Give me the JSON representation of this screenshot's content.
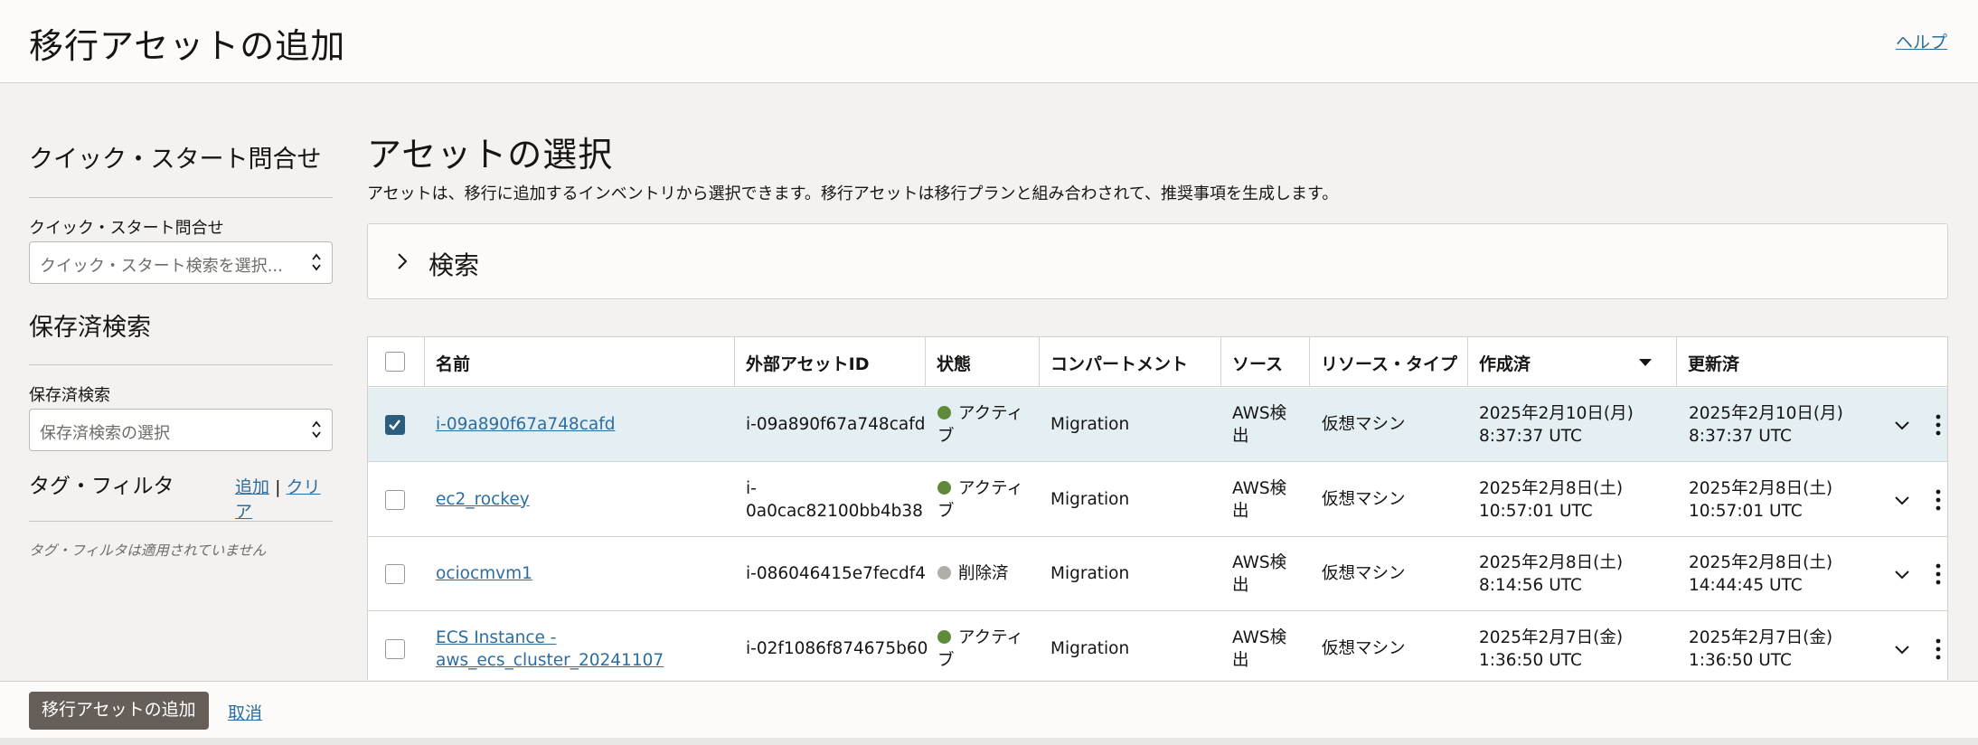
{
  "header": {
    "title": "移行アセットの追加",
    "help": "ヘルプ"
  },
  "sidebar": {
    "quick_start": {
      "heading": "クイック・スタート問合せ",
      "label": "クイック・スタート問合せ",
      "placeholder": "クイック・スタート検索を選択..."
    },
    "saved_search": {
      "heading": "保存済検索",
      "label": "保存済検索",
      "placeholder": "保存済検索の選択"
    },
    "tag_filter": {
      "heading": "タグ・フィルタ",
      "add": "追加",
      "separator": "|",
      "clear": "クリア",
      "empty": "タグ・フィルタは適用されていません"
    }
  },
  "main": {
    "title": "アセットの選択",
    "description": "アセットは、移行に追加するインベントリから選択できます。移行アセットは移行プランと組み合わされて、推奨事項を生成します。",
    "search_label": "検索"
  },
  "table": {
    "columns": {
      "name": "名前",
      "external_id": "外部アセットID",
      "state": "状態",
      "compartment": "コンパートメント",
      "source": "ソース",
      "resource_type": "リソース・タイプ",
      "created": "作成済",
      "updated": "更新済"
    },
    "rows": [
      {
        "selected": true,
        "name_1": "i-09a890f67a748cafd",
        "name_2": "",
        "ext_1": "i-09a890f67a748cafd",
        "ext_2": "",
        "state_1": "アクティ",
        "state_2": "ブ",
        "state_color": "#5f8a3a",
        "compartment": "Migration",
        "source_1": "AWS検",
        "source_2": "出",
        "resource_type": "仮想マシン",
        "created_1": "2025年2月10日(月)",
        "created_2": "8:37:37 UTC",
        "updated_1": "2025年2月10日(月)",
        "updated_2": "8:37:37 UTC"
      },
      {
        "selected": false,
        "name_1": "ec2_rockey",
        "name_2": "",
        "ext_1": "i-",
        "ext_2": "0a0cac82100bb4b38",
        "state_1": "アクティ",
        "state_2": "ブ",
        "state_color": "#5f8a3a",
        "compartment": "Migration",
        "source_1": "AWS検",
        "source_2": "出",
        "resource_type": "仮想マシン",
        "created_1": "2025年2月8日(土)",
        "created_2": "10:57:01 UTC",
        "updated_1": "2025年2月8日(土)",
        "updated_2": "10:57:01 UTC"
      },
      {
        "selected": false,
        "name_1": "ociocmvm1",
        "name_2": "",
        "ext_1": "i-086046415e7fecdf4",
        "ext_2": "",
        "state_1": "削除済",
        "state_2": "",
        "state_color": "#b1ada7",
        "compartment": "Migration",
        "source_1": "AWS検",
        "source_2": "出",
        "resource_type": "仮想マシン",
        "created_1": "2025年2月8日(土)",
        "created_2": "8:14:56 UTC",
        "updated_1": "2025年2月8日(土)",
        "updated_2": "14:44:45 UTC"
      },
      {
        "selected": false,
        "name_1": "ECS Instance -",
        "name_2": "aws_ecs_cluster_20241107",
        "ext_1": "i-02f1086f874675b60",
        "ext_2": "",
        "state_1": "アクティ",
        "state_2": "ブ",
        "state_color": "#5f8a3a",
        "compartment": "Migration",
        "source_1": "AWS検",
        "source_2": "出",
        "resource_type": "仮想マシン",
        "created_1": "2025年2月7日(金)",
        "created_2": "1:36:50 UTC",
        "updated_1": "2025年2月7日(金)",
        "updated_2": "1:36:50 UTC"
      }
    ]
  },
  "footer": {
    "add_button": "移行アセットの追加",
    "cancel": "取消"
  }
}
